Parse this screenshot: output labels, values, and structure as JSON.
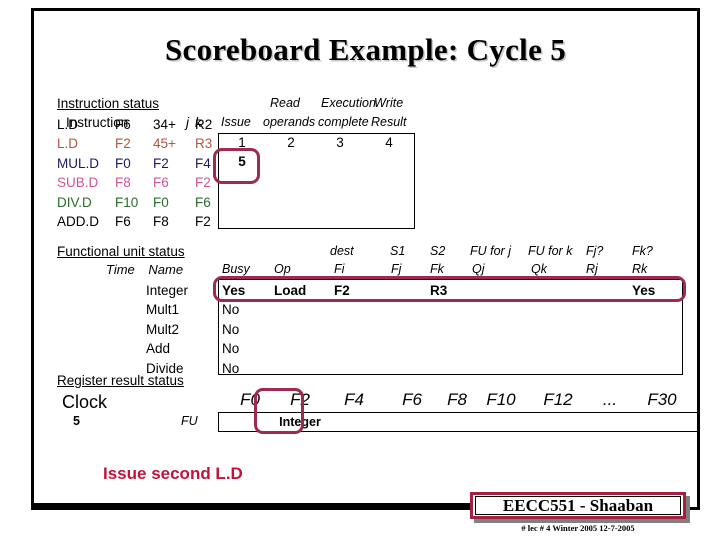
{
  "slide": {
    "title": "Scoreboard Example:  Cycle 5",
    "caption": "Issue second L.D"
  },
  "instruction_status": {
    "section_label": "Instruction status",
    "row_headers": {
      "instruction": "Instruction",
      "j": "j",
      "k": "k"
    },
    "col_headers": {
      "issue": "Issue",
      "read_operands_1": "Read",
      "read_operands_2": "operands",
      "execution_complete_1": "Execution",
      "execution_complete_2": "complete",
      "write_result_1": "Write",
      "write_result_2": "Result"
    },
    "rows": [
      {
        "op": "L.D",
        "dest": "F6",
        "j": "34+",
        "k": "R2",
        "color": "#000000"
      },
      {
        "op": "L.D",
        "dest": "F2",
        "j": "45+",
        "k": "R3",
        "color": "#b5543f"
      },
      {
        "op": "MUL.D",
        "dest": "F0",
        "j": "F2",
        "k": "F4",
        "color": "#1a1a5e"
      },
      {
        "op": "SUB.D",
        "dest": "F8",
        "j": "F6",
        "k": "F2",
        "color": "#cc5599"
      },
      {
        "op": "DIV.D",
        "dest": "F10",
        "j": "F0",
        "k": "F6",
        "color": "#2d6b2d"
      },
      {
        "op": "ADD.D",
        "dest": "F6",
        "j": "F8",
        "k": "F2",
        "color": "#000000"
      }
    ],
    "cells": [
      {
        "issue": "1",
        "read": "2",
        "exec": "3",
        "write": "4",
        "bold": false
      },
      {
        "issue": "5",
        "read": "",
        "exec": "",
        "write": "",
        "bold": true
      },
      {
        "issue": "",
        "read": "",
        "exec": "",
        "write": "",
        "bold": false
      },
      {
        "issue": "",
        "read": "",
        "exec": "",
        "write": "",
        "bold": false
      },
      {
        "issue": "",
        "read": "",
        "exec": "",
        "write": "",
        "bold": false
      }
    ]
  },
  "functional_unit_status": {
    "section_label": "Functional unit status",
    "time_label": "Time",
    "name_label": "Name",
    "col_headers": {
      "busy": "Busy",
      "op": "Op",
      "dest_top": "dest",
      "fi": "Fi",
      "s1_top": "S1",
      "fj": "Fj",
      "s2_top": "S2",
      "fk": "Fk",
      "fu_for_j": "FU for j",
      "qj": "Qj",
      "fu_for_k": "FU for k",
      "qk": "Qk",
      "fj_q": "Fj?",
      "rj": "Rj",
      "fk_q": "Fk?",
      "rk": "Rk"
    },
    "rows": [
      {
        "name": "Integer",
        "busy": "Yes",
        "op": "Load",
        "fi": "F2",
        "fj": "",
        "fk": "R3",
        "qj": "",
        "qk": "",
        "rj": "",
        "rk": "Yes",
        "bold": true
      },
      {
        "name": "Mult1",
        "busy": "No",
        "op": "",
        "fi": "",
        "fj": "",
        "fk": "",
        "qj": "",
        "qk": "",
        "rj": "",
        "rk": "",
        "bold": false
      },
      {
        "name": "Mult2",
        "busy": "No",
        "op": "",
        "fi": "",
        "fj": "",
        "fk": "",
        "qj": "",
        "qk": "",
        "rj": "",
        "rk": "",
        "bold": false
      },
      {
        "name": "Add",
        "busy": "No",
        "op": "",
        "fi": "",
        "fj": "",
        "fk": "",
        "qj": "",
        "qk": "",
        "rj": "",
        "rk": "",
        "bold": false
      },
      {
        "name": "Divide",
        "busy": "No",
        "op": "",
        "fi": "",
        "fj": "",
        "fk": "",
        "qj": "",
        "qk": "",
        "rj": "",
        "rk": "",
        "bold": false
      }
    ]
  },
  "register_result_status": {
    "section_label": "Register result status",
    "clock_label": "Clock",
    "clock_value": "5",
    "fu_label": "FU",
    "registers": [
      "F0",
      "F2",
      "F4",
      "F6",
      "F8",
      "F10",
      "F12",
      "...",
      "F30"
    ],
    "values": [
      "",
      "Integer",
      "",
      "",
      "",
      "",
      "",
      "",
      ""
    ]
  },
  "footer": {
    "badge": "EECC551 - Shaaban",
    "note": "#  lec # 4 Winter 2005   12-7-2005"
  },
  "colors": {
    "highlight": "#9e2b4e",
    "caption": "#c0143c",
    "badge_border": "#a32040"
  }
}
